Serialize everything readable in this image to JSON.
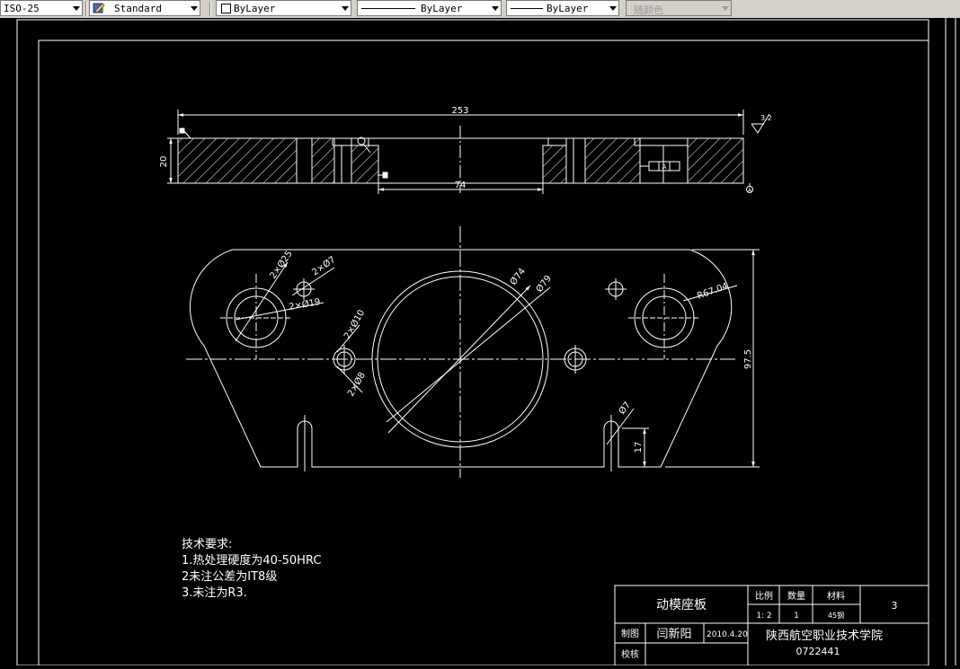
{
  "toolbar": {
    "dimstyle": "ISO-25",
    "textstyle": "Standard",
    "layer": "ByLayer",
    "linetype": "ByLayer",
    "lineweight": "ByLayer",
    "plotstyle": "随颜色"
  },
  "dims": {
    "overall": "253",
    "thickness": "20",
    "bore_depth": "74",
    "rough_top": "3.2",
    "height": "97.5",
    "slot_h": "17",
    "r_corner": "R67.04",
    "d74": "Ø74",
    "d79": "Ø79",
    "d7": "Ø7",
    "c2_d25": "2×Ø25",
    "c2_d7": "2×Ø7",
    "c2_d19": "2×Ø19",
    "c2_d10": "2×Ø10",
    "c2_d8": "2×Ø8",
    "gtol_text": "A",
    "datum": "A"
  },
  "notes": {
    "title": "技术要求:",
    "line1": "1.热处理硬度为40-50HRC",
    "line2": "2未注公差为IT8级",
    "line3": "3.未注为R3."
  },
  "title_block": {
    "part_name": "动模座板",
    "scale_label": "比例",
    "qty_label": "数量",
    "material_label": "材料",
    "sheet_no": "3",
    "scale": "1: 2",
    "qty": "1",
    "material": "45钢",
    "drawn_label": "制图",
    "drawn_by": "闫新阳",
    "date": "2010.4.20",
    "checked_label": "校核",
    "school": "陕西航空职业技术学院",
    "code": "0722441"
  },
  "colors": {
    "background": "#000000",
    "line": "#ffffff",
    "toolbar": "#d4d0c8"
  }
}
